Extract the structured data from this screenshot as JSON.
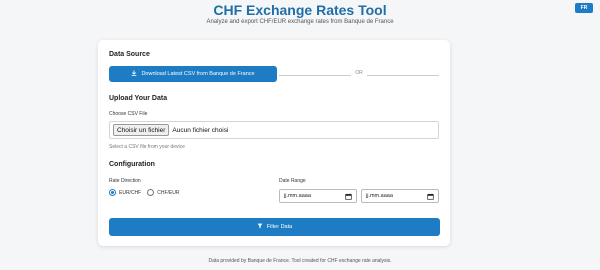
{
  "lang_button": "FR",
  "header": {
    "title": "CHF Exchange Rates Tool",
    "subtitle": "Analyze and export CHF/EUR exchange rates from Banque de France"
  },
  "data_source": {
    "title": "Data Source",
    "download_label": "Download Latest CSV from Banque de France",
    "or_text": "OR"
  },
  "upload": {
    "title": "Upload Your Data",
    "file_label": "Choose CSV File",
    "file_button": "Choisir un fichier",
    "file_status": "Aucun fichier choisi",
    "help": "Select a CSV file from your device"
  },
  "config": {
    "title": "Configuration",
    "rate_direction_label": "Rate Direction",
    "options": [
      "EUR/CHF",
      "CHF/EUR"
    ],
    "selected": "EUR/CHF",
    "date_range_label": "Date Range",
    "date_start_placeholder": "jj.mm.aaaa",
    "date_end_placeholder": "jj.mm.aaaa"
  },
  "filter_button": "Filter Data",
  "footer": "Data provided by Banque de France. Tool created for CHF exchange rate analysis.",
  "colors": {
    "accent": "#1e7cc4",
    "title": "#1e6ea8"
  }
}
